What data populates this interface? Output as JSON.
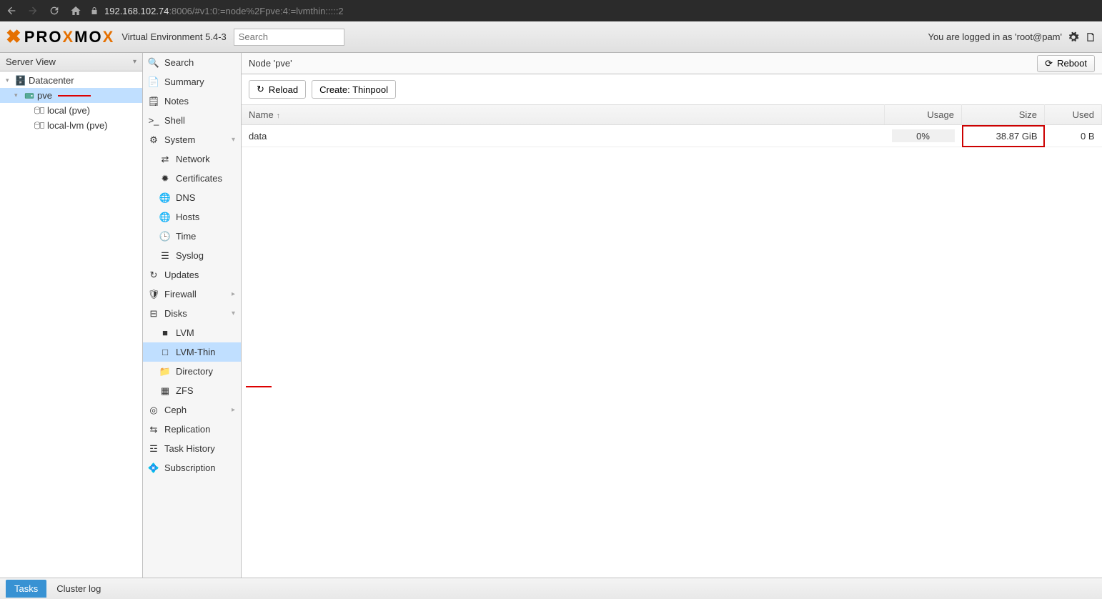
{
  "browser": {
    "url_host": "192.168.102.74",
    "url_port": ":8006",
    "url_path": "/#v1:0:=node%2Fpve:4:=lvmthin:::::2"
  },
  "header": {
    "logo_text": "PROXMOX",
    "version": "Virtual Environment 5.4-3",
    "search_placeholder": "Search",
    "login_text": "You are logged in as 'root@pam'"
  },
  "tree": {
    "view_selector": "Server View",
    "root": "Datacenter",
    "node": "pve",
    "storage1": "local (pve)",
    "storage2": "local-lvm (pve)"
  },
  "midnav": {
    "search": "Search",
    "summary": "Summary",
    "notes": "Notes",
    "shell": "Shell",
    "system": "System",
    "network": "Network",
    "certificates": "Certificates",
    "dns": "DNS",
    "hosts": "Hosts",
    "time": "Time",
    "syslog": "Syslog",
    "updates": "Updates",
    "firewall": "Firewall",
    "disks": "Disks",
    "lvm": "LVM",
    "lvmthin": "LVM-Thin",
    "directory": "Directory",
    "zfs": "ZFS",
    "ceph": "Ceph",
    "replication": "Replication",
    "task_history": "Task History",
    "subscription": "Subscription"
  },
  "content": {
    "title": "Node 'pve'",
    "reboot_btn": "Reboot",
    "reload_btn": "Reload",
    "create_btn": "Create: Thinpool"
  },
  "table": {
    "col_name": "Name",
    "col_usage": "Usage",
    "col_size": "Size",
    "col_used": "Used",
    "rows": [
      {
        "name": "data",
        "usage": "0%",
        "size": "38.87 GiB",
        "used": "0 B"
      }
    ]
  },
  "bottom": {
    "tasks": "Tasks",
    "cluster_log": "Cluster log"
  }
}
